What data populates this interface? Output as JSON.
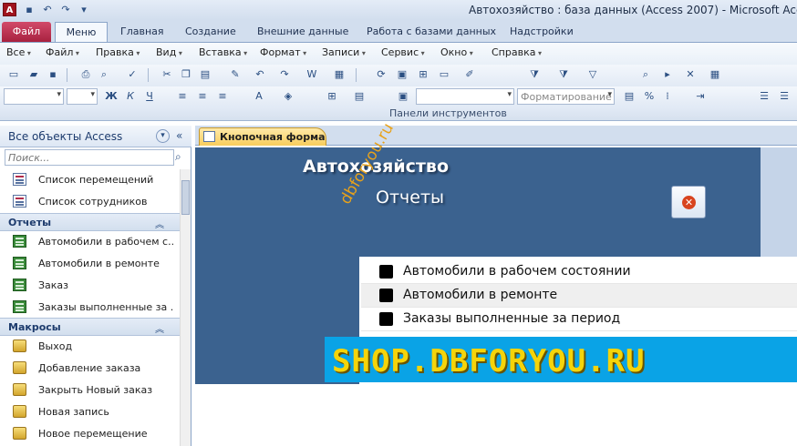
{
  "window": {
    "title": "Автохозяйство : база данных (Access 2007)  -  Microsoft Access",
    "app_icon_letter": "A"
  },
  "ribbon_tabs": [
    {
      "label": "Файл"
    },
    {
      "label": "Меню"
    },
    {
      "label": "Главная"
    },
    {
      "label": "Создание"
    },
    {
      "label": "Внешние данные"
    },
    {
      "label": "Работа с базами данных"
    },
    {
      "label": "Надстройки"
    }
  ],
  "menu": [
    {
      "label": "Все"
    },
    {
      "label": "Файл"
    },
    {
      "label": "Правка"
    },
    {
      "label": "Вид"
    },
    {
      "label": "Вставка"
    },
    {
      "label": "Формат"
    },
    {
      "label": "Записи"
    },
    {
      "label": "Сервис"
    },
    {
      "label": "Окно"
    },
    {
      "label": "Справка"
    }
  ],
  "toolbar": {
    "format_combo_placeholder": "Форматирование",
    "group_label": "Панели инструментов"
  },
  "nav": {
    "title": "Все объекты Access",
    "search_placeholder": "Поиск...",
    "forms": [
      {
        "label": "Список перемещений"
      },
      {
        "label": "Список сотрудников"
      }
    ],
    "reports_group": "Отчеты",
    "reports": [
      {
        "label": "Автомобили в рабочем с..."
      },
      {
        "label": "Автомобили в ремонте"
      },
      {
        "label": "Заказ"
      },
      {
        "label": "Заказы выполненные за ..."
      }
    ],
    "macros_group": "Макросы",
    "macros": [
      {
        "label": "Выход"
      },
      {
        "label": "Добавление заказа"
      },
      {
        "label": "Закрыть Новый заказ"
      },
      {
        "label": "Новая запись"
      },
      {
        "label": "Новое перемещение"
      }
    ]
  },
  "document": {
    "tab_label": "Кнопочная форма",
    "form_title": "Автохозяйство",
    "form_subtitle": "Отчеты",
    "watermark": "dbforyou.ru",
    "switchboard_items": [
      {
        "label": "Автомобили в рабочем состоянии"
      },
      {
        "label": "Автомобили в ремонте"
      },
      {
        "label": "Заказы выполненные за период"
      }
    ],
    "banner": "SHOP.DBFORYOU.RU"
  }
}
